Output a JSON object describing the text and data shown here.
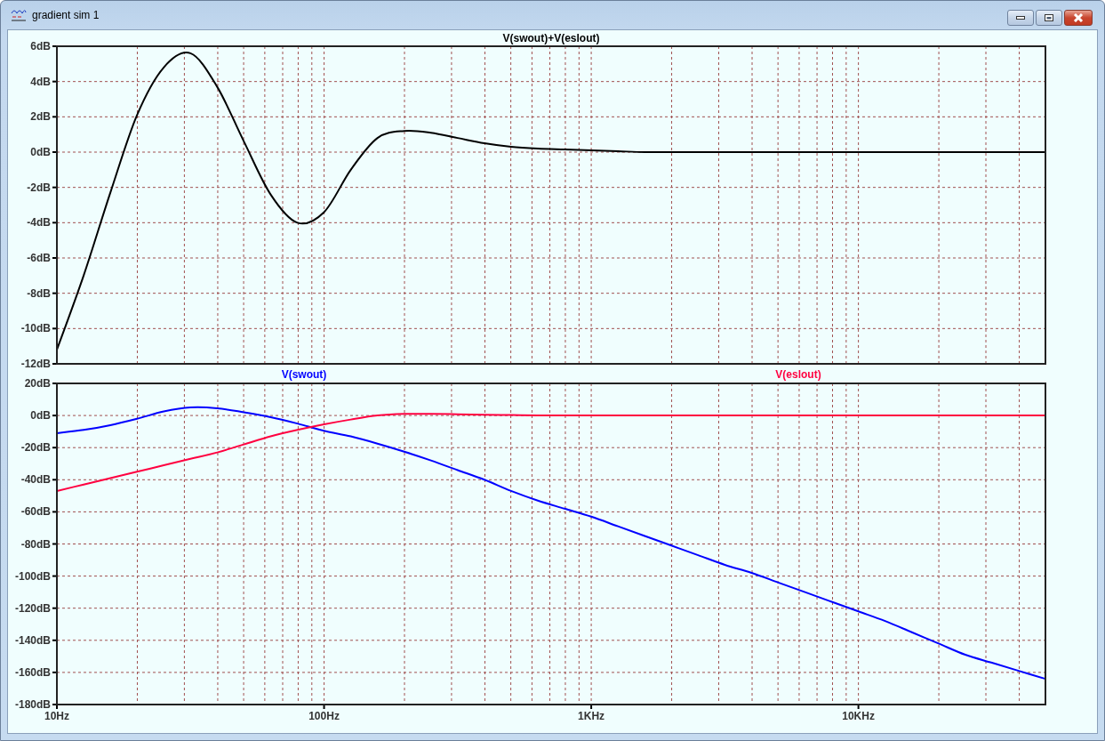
{
  "window": {
    "title": "gradient sim 1",
    "buttons": [
      {
        "kind": "minimize"
      },
      {
        "kind": "maximize"
      },
      {
        "kind": "close"
      }
    ]
  },
  "panes": [
    {
      "chart_data": {
        "type": "line",
        "grid": true,
        "ylim": [
          -12,
          6
        ],
        "yticks": [
          {
            "value": 6,
            "label": "6dB"
          },
          {
            "value": 4,
            "label": "4dB"
          },
          {
            "value": 2,
            "label": "2dB"
          },
          {
            "value": 0,
            "label": "0dB"
          },
          {
            "value": -2,
            "label": "-2dB"
          },
          {
            "value": -4,
            "label": "-4dB"
          },
          {
            "value": -6,
            "label": "-6dB"
          },
          {
            "value": -8,
            "label": "-8dB"
          },
          {
            "value": -10,
            "label": "-10dB"
          },
          {
            "value": -12,
            "label": "-12dB"
          }
        ],
        "categories": [
          null,
          null,
          null,
          null,
          null,
          null,
          null,
          null,
          null,
          null,
          null,
          null,
          null,
          null,
          null,
          null,
          null,
          null,
          null,
          null,
          null,
          null,
          null,
          null,
          null,
          null,
          null,
          null,
          null,
          null,
          null,
          null,
          null,
          null,
          null,
          null,
          null,
          null
        ],
        "series": [
          {
            "name": "V(swout)+V(eslout)",
            "color": "#000000",
            "values": [
              -11.2,
              -7,
              -2.3,
              2.1,
              4.8,
              5.6,
              3.7,
              0.6,
              -2.4,
              -4,
              -3.4,
              -1,
              0.8,
              1.2,
              1.1,
              0.8,
              0.5,
              0.3,
              0.2,
              0.15,
              0.1,
              0.05,
              0,
              0,
              0,
              0,
              0,
              0,
              0,
              0,
              0,
              0,
              0,
              0,
              0,
              0,
              0,
              0
            ]
          }
        ]
      }
    },
    {
      "chart_data": {
        "type": "line",
        "grid": true,
        "ylim": [
          -180,
          20
        ],
        "yticks": [
          {
            "value": 20,
            "label": "20dB"
          },
          {
            "value": 0,
            "label": "0dB"
          },
          {
            "value": -20,
            "label": "-20dB"
          },
          {
            "value": -40,
            "label": "-40dB"
          },
          {
            "value": -60,
            "label": "-60dB"
          },
          {
            "value": -80,
            "label": "-80dB"
          },
          {
            "value": -100,
            "label": "-100dB"
          },
          {
            "value": -120,
            "label": "-120dB"
          },
          {
            "value": -140,
            "label": "-140dB"
          },
          {
            "value": -160,
            "label": "-160dB"
          },
          {
            "value": -180,
            "label": "-180dB"
          }
        ],
        "categories": [
          "10Hz",
          null,
          null,
          null,
          null,
          null,
          null,
          null,
          null,
          null,
          "100Hz",
          null,
          null,
          null,
          null,
          null,
          null,
          null,
          null,
          null,
          "1KHz",
          null,
          null,
          null,
          null,
          null,
          null,
          null,
          null,
          null,
          "10KHz",
          null,
          null,
          null,
          null,
          null,
          null,
          null
        ],
        "series": [
          {
            "name": "V(swout)",
            "color": "#0000ff",
            "values": [
              -11,
              -9,
              -6,
              -2,
              2.5,
              5,
              4.5,
              2,
              -1,
              -5,
              -9.5,
              -13,
              -17.5,
              -22.5,
              -28,
              -34,
              -40,
              -47,
              -53,
              -58,
              -63,
              -69,
              -75,
              -81,
              -87,
              -93,
              -98,
              -104,
              -110,
              -116,
              -122,
              -128,
              -135,
              -142,
              -149,
              -154,
              -159,
              -164
            ]
          },
          {
            "name": "V(eslout)",
            "color": "#ff0040",
            "values": [
              -47,
              -43,
              -39,
              -35,
              -31,
              -27,
              -23,
              -18,
              -13,
              -9,
              -5.5,
              -2.5,
              0,
              1,
              1,
              0.8,
              0.5,
              0.3,
              0.1,
              0,
              0,
              0,
              0,
              0,
              0,
              0,
              0,
              0,
              0,
              0,
              0,
              0,
              0,
              0,
              0,
              0,
              0,
              0
            ]
          }
        ]
      }
    }
  ]
}
